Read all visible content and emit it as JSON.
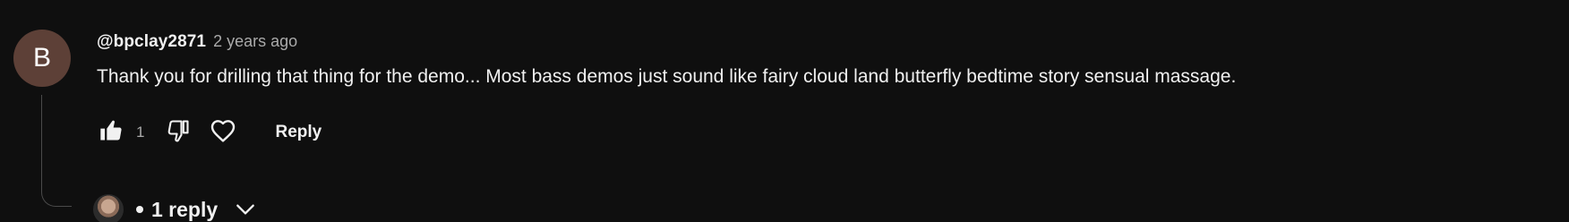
{
  "comment": {
    "avatar_letter": "B",
    "avatar_color": "#5d4037",
    "author": "@bpclay2871",
    "time": "2 years ago",
    "text": "Thank you for drilling that thing for the demo... Most bass demos just sound like fairy cloud land butterfly bedtime story sensual massage.",
    "like_count": "1",
    "reply_label": "Reply",
    "replies_label": "1 reply"
  },
  "icons": {
    "like": "thumbs-up-icon",
    "dislike": "thumbs-down-icon",
    "heart": "heart-icon",
    "expand": "chevron-down-icon"
  },
  "colors": {
    "background": "#0f0f0f",
    "primary_text": "#f1f1f1",
    "secondary_text": "#aaaaaa"
  }
}
